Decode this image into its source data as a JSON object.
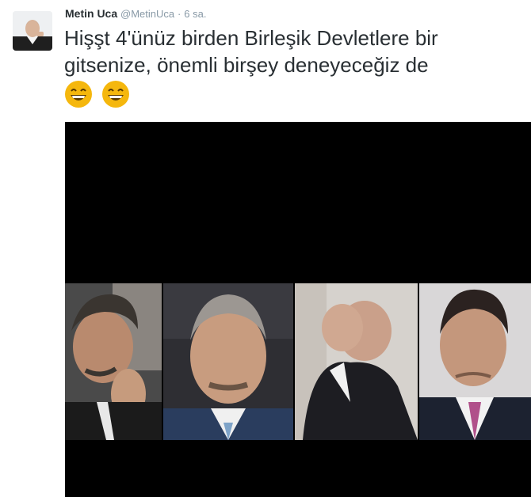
{
  "tweet": {
    "name": "Metin Uca",
    "handle": "@MetinUca",
    "separator": "·",
    "time": "6 sa.",
    "text_line1": "Hişşt 4'ünüz birden Birleşik Devletlere bir",
    "text_line2": "gitsenize, önemli birşey deneyeceğiz de",
    "emojis": [
      "grinning-face-emoji",
      "grinning-face-emoji"
    ]
  },
  "colors": {
    "name": "#292f33",
    "meta": "#8899a6",
    "emoji_face": "#f5b70d",
    "media_bg": "#000000"
  }
}
